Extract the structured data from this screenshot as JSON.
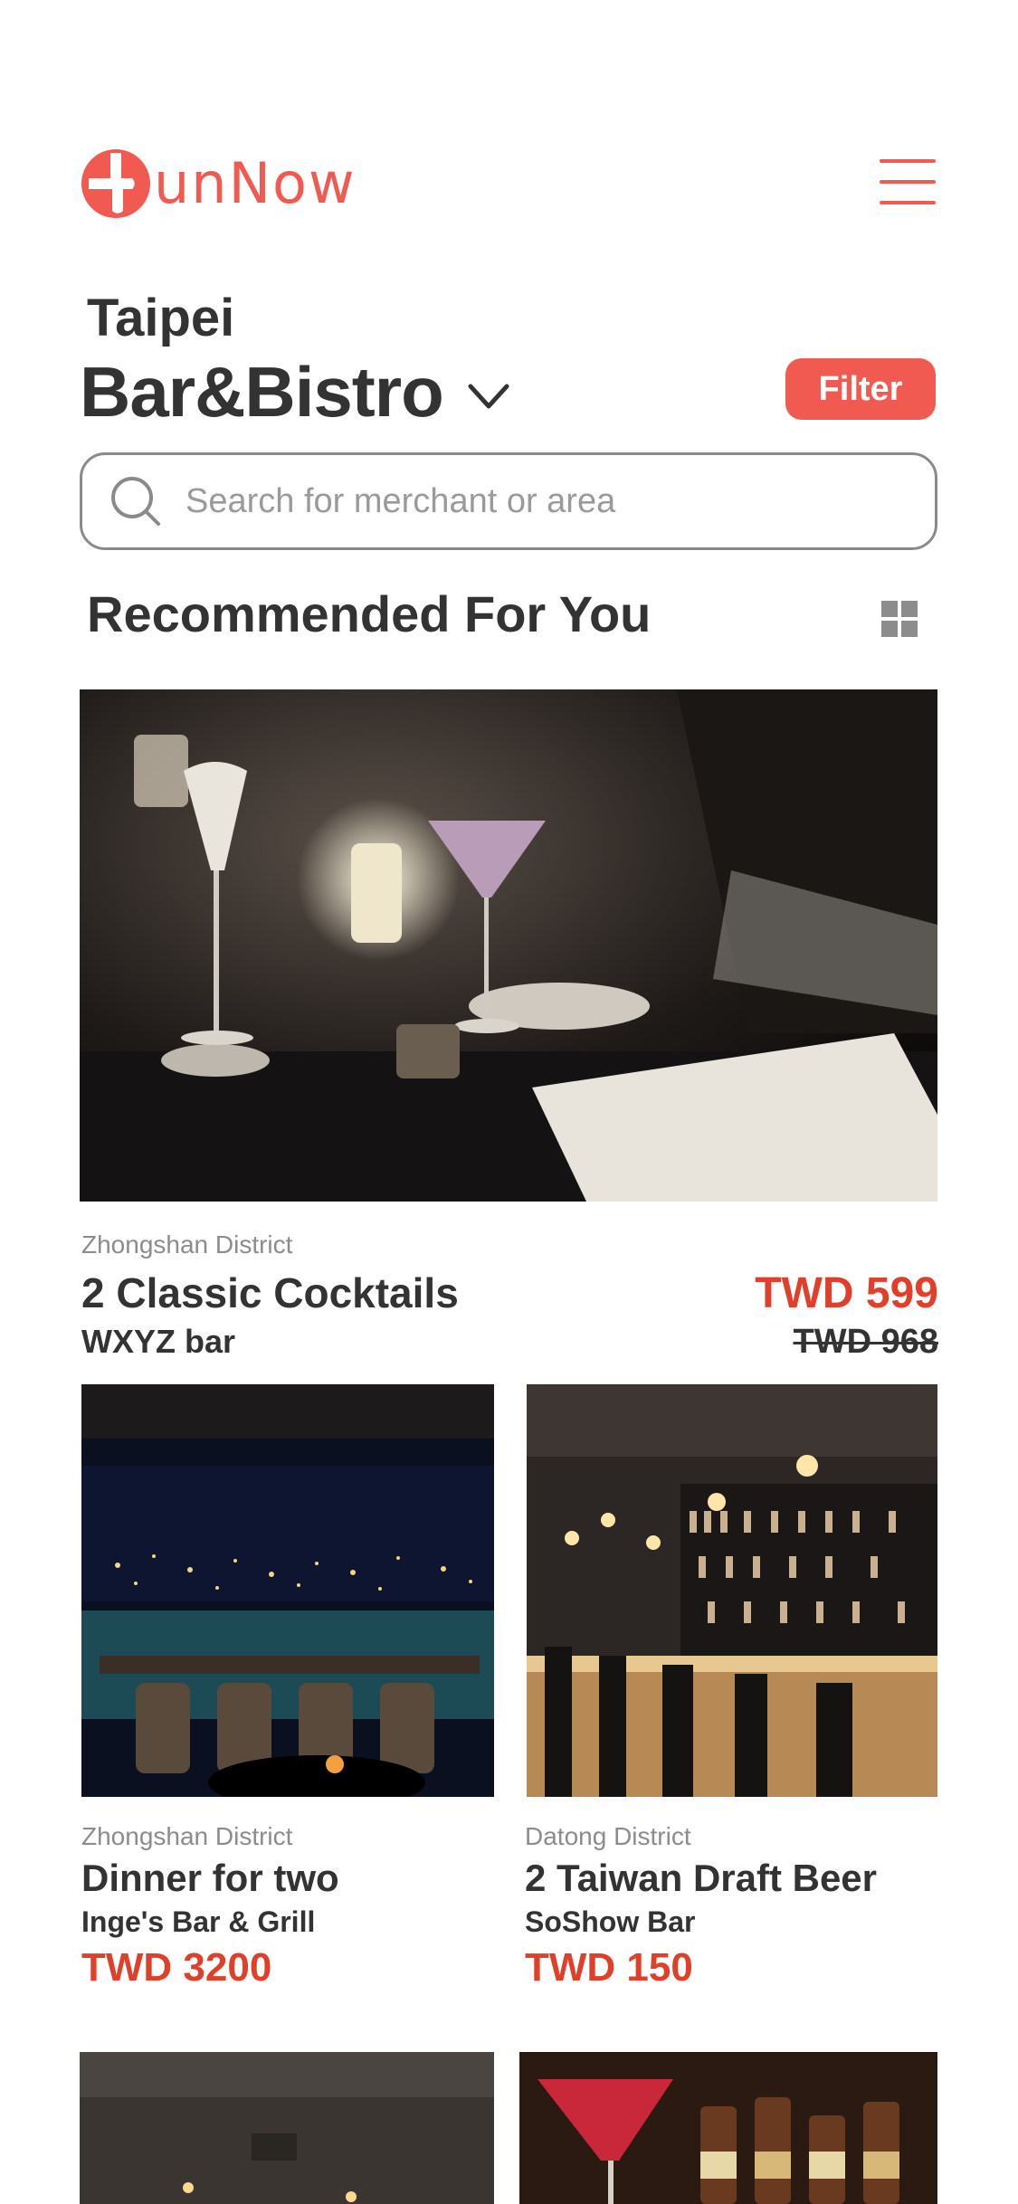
{
  "header": {
    "logo_text": "unNow",
    "menu_icon": "hamburger-menu-icon"
  },
  "location": {
    "city": "Taipei",
    "category": "Bar&Bistro"
  },
  "filter": {
    "label": "Filter"
  },
  "search": {
    "placeholder": "Search for merchant or area"
  },
  "section": {
    "title": "Recommended For You"
  },
  "colors": {
    "brand": "#f05a50",
    "price": "#e0402a",
    "text": "#333333",
    "muted": "#8c8c8c"
  },
  "deals": [
    {
      "district": "Zhongshan District",
      "title": "2 Classic Cocktails",
      "merchant": "WXYZ bar",
      "price": "TWD 599",
      "original_price": "TWD 968"
    },
    {
      "district": "Zhongshan District",
      "title": "Dinner for two",
      "merchant": "Inge's Bar & Grill",
      "price": "TWD 3200"
    },
    {
      "district": "Datong District",
      "title": "2 Taiwan Draft Beer",
      "merchant": "SoShow Bar",
      "price": "TWD 150"
    }
  ]
}
